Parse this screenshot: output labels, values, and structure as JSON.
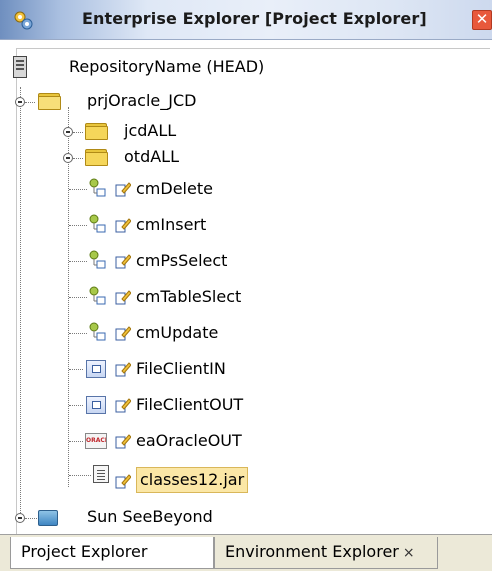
{
  "window": {
    "title": "Enterprise Explorer [Project Explorer]",
    "close_label": "✕",
    "title_icon": "explorer-gear-icon"
  },
  "tree": {
    "root": {
      "label": "RepositoryName (HEAD)",
      "icon": "repository-icon"
    },
    "project": {
      "label": "prjOracle_JCD",
      "icon": "open-folder-icon"
    },
    "folders": [
      {
        "label": "jcdALL",
        "icon": "folder-icon"
      },
      {
        "label": "otdALL",
        "icon": "folder-icon"
      }
    ],
    "items": [
      {
        "label": "cmDelete",
        "icon": "connectivity-map-icon"
      },
      {
        "label": "cmInsert",
        "icon": "connectivity-map-icon"
      },
      {
        "label": "cmPsSelect",
        "icon": "connectivity-map-icon"
      },
      {
        "label": "cmTableSlect",
        "icon": "connectivity-map-icon"
      },
      {
        "label": "cmUpdate",
        "icon": "connectivity-map-icon"
      },
      {
        "label": "FileClientIN",
        "icon": "external-app-icon"
      },
      {
        "label": "FileClientOUT",
        "icon": "external-app-icon"
      },
      {
        "label": "eaOracleOUT",
        "icon": "oracle-icon"
      },
      {
        "label": "classes12.jar",
        "icon": "jar-file-icon",
        "selected": true
      }
    ],
    "sibling": {
      "label": "Sun SeeBeyond",
      "icon": "sun-seebeyond-icon"
    },
    "oracle_logo_text": "ORACLE"
  },
  "tabs": [
    {
      "label": "Project Explorer",
      "active": true
    },
    {
      "label": "Environment Explorer",
      "close": "×",
      "active": false
    }
  ]
}
